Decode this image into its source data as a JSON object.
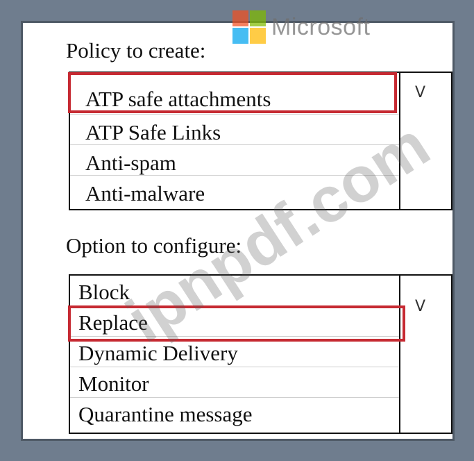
{
  "brand": {
    "name": "Microsoft",
    "colors": [
      "#f25022",
      "#7fba00",
      "#00a4ef",
      "#ffb900"
    ]
  },
  "policy": {
    "label": "Policy to create:",
    "chevron": "V",
    "options": [
      "ATP safe attachments",
      "ATP Safe Links",
      "Anti-spam",
      "Anti-malware"
    ],
    "selected": "ATP safe attachments"
  },
  "option": {
    "label": "Option to configure:",
    "chevron": "V",
    "options": [
      "Block",
      "Replace",
      "Dynamic Delivery",
      "Monitor",
      "Quarantine message"
    ],
    "selected": "Replace"
  },
  "watermark": "ipnpdf.com",
  "highlight_color": "#c62a32"
}
